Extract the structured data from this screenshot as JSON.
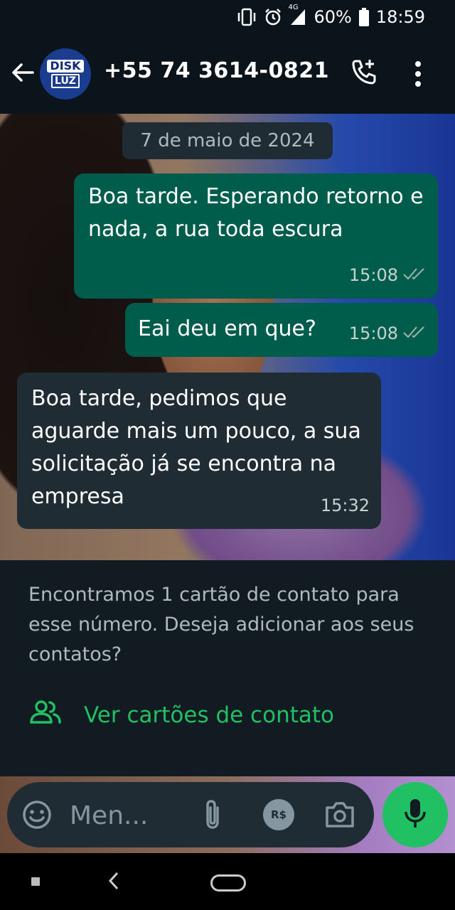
{
  "status_bar": {
    "network": "4G",
    "battery": "60%",
    "time": "18:59"
  },
  "header": {
    "contact_name": "+55 74 3614-0821",
    "avatar_logo_top": "DISK",
    "avatar_logo_bottom": "LUZ"
  },
  "chat": {
    "date_chip": "7 de maio de 2024",
    "messages": [
      {
        "direction": "outgoing",
        "text": "Boa tarde. Esperando retorno e nada, a rua toda escura",
        "time": "15:08",
        "status": "read"
      },
      {
        "direction": "outgoing",
        "text": "Eai deu em que?",
        "time": "15:08",
        "status": "read"
      },
      {
        "direction": "incoming",
        "text": "Boa tarde, pedimos que aguarde mais um pouco, a sua solicitação já se encontra na empresa",
        "time": "15:32"
      }
    ]
  },
  "notice": {
    "text": "Encontramos 1 cartão de contato para esse número. Deseja adicionar aos seus contatos?",
    "link_label": "Ver cartões de contato"
  },
  "composer": {
    "placeholder": "Men...",
    "pay_label": "R$"
  },
  "colors": {
    "outgoing_bubble": "#005c4b",
    "incoming_bubble": "#202c33",
    "accent": "#21c063",
    "background": "#111b21"
  }
}
